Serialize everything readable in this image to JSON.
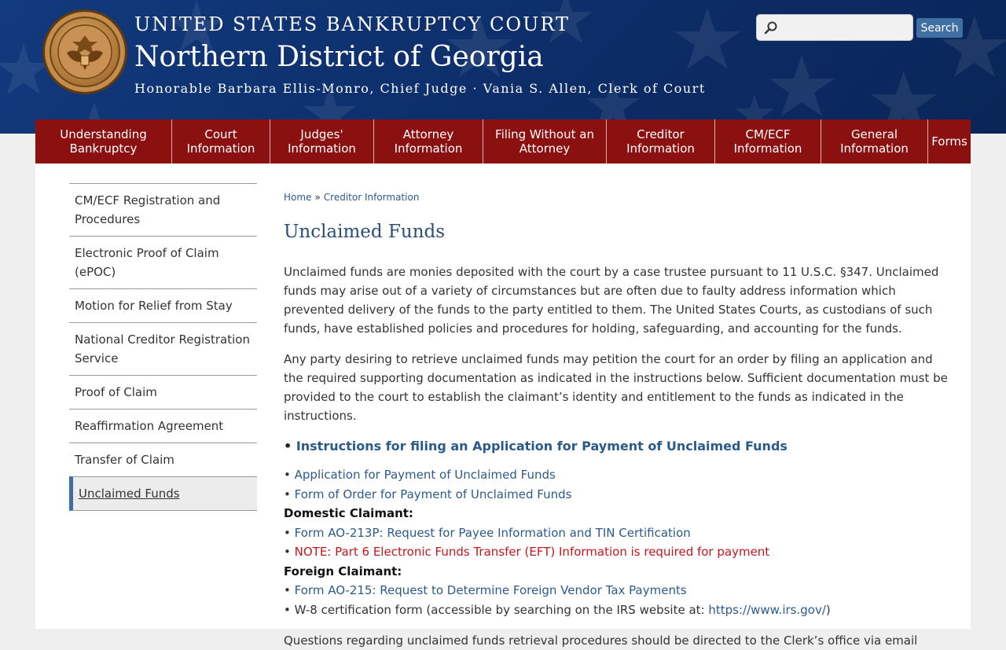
{
  "header": {
    "line1": "UNITED STATES BANKRUPTCY COURT",
    "line2": "Northern District of Georgia",
    "line3": "Honorable Barbara Ellis-Monro, Chief Judge  · Vania S. Allen, Clerk of Court",
    "seal_text_top": "UNITED STATES BANKRUPTCY COURT",
    "seal_text_bottom": "NORTHERN DISTRICT OF GEORGIA",
    "colors": {
      "banner": "#0f3270",
      "nav": "#8b1111",
      "link": "#2d5a8c",
      "alert": "#c8151b"
    }
  },
  "search": {
    "placeholder": "",
    "value": "",
    "button_label": "Search",
    "icon": "search-icon"
  },
  "nav": {
    "items": [
      {
        "label": "Understanding Bankruptcy"
      },
      {
        "label": "Court Information"
      },
      {
        "label": "Judges' Information"
      },
      {
        "label": "Attorney Information"
      },
      {
        "label": "Filing Without an Attorney"
      },
      {
        "label": "Creditor Information"
      },
      {
        "label": "CM/ECF Information"
      },
      {
        "label": "General Information"
      },
      {
        "label": "Forms"
      }
    ]
  },
  "sidebar": {
    "items": [
      {
        "label": "CM/ECF Registration and Procedures"
      },
      {
        "label": "Electronic Proof of Claim (ePOC)"
      },
      {
        "label": "Motion for Relief from Stay"
      },
      {
        "label": "National Creditor Registration Service"
      },
      {
        "label": "Proof of Claim"
      },
      {
        "label": "Reaffirmation Agreement"
      },
      {
        "label": "Transfer of Claim"
      },
      {
        "label": "Unclaimed Funds"
      }
    ],
    "active": "Unclaimed Funds"
  },
  "breadcrumb": {
    "home": "Home",
    "separator": "»",
    "current": "Creditor Information"
  },
  "main": {
    "title": "Unclaimed Funds",
    "para1": "Unclaimed funds are monies deposited with the court by a case trustee pursuant to 11 U.S.C. §347. Unclaimed funds may arise out of a variety of circumstances but are often due to faulty address information which prevented delivery of the funds to the party entitled to them. The United States Courts, as custodians of such funds, have established policies and procedures for holding, safeguarding, and accounting for the funds.",
    "para2": "Any party desiring to retrieve unclaimed funds may petition the court for an order by filing an application and the required supporting documentation as indicated in the instructions below. Sufficient documentation must be provided to the court to establish the claimant’s identity and entitlement to the funds as indicated in the instructions.",
    "instructions_link": "Instructions for filing an Application for Payment of Unclaimed Funds",
    "bullet": "•",
    "link_application": "Application for Payment of Unclaimed Funds",
    "link_order": "Form of Order for Payment of Unclaimed Funds",
    "domestic_header": "Domestic Claimant:",
    "link_ao213p": "Form AO-213P: Request for Payee Information and TIN Certification",
    "note_eft": "NOTE: Part 6 Electronic Funds Transfer (EFT) Information is required for payment",
    "foreign_header": "Foreign Claimant:",
    "link_ao215": "Form AO-215: Request to Determine Foreign Vendor Tax Payments",
    "w8_text": "W-8 certification form (accessible by searching on the IRS website at: ",
    "irs_link": "https://www.irs.gov/",
    "w8_close": ")",
    "para3": "Questions regarding unclaimed funds retrieval procedures should be directed to the Clerk’s office via email"
  }
}
